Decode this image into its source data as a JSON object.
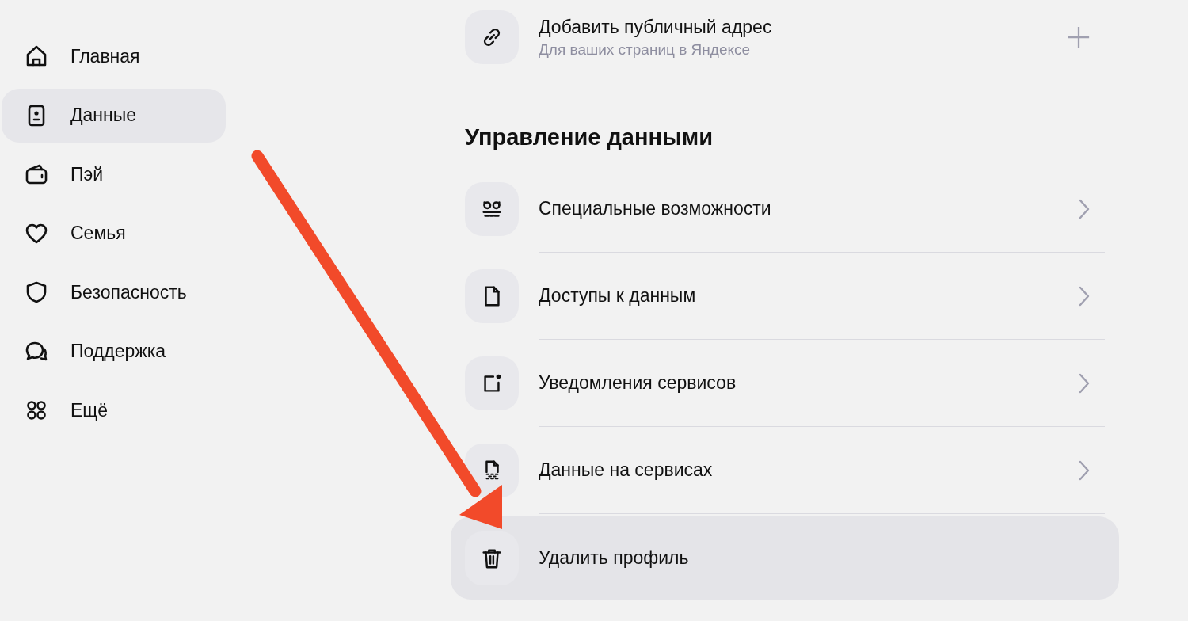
{
  "sidebar": {
    "items": [
      {
        "label": "Главная",
        "selected": false
      },
      {
        "label": "Данные",
        "selected": true
      },
      {
        "label": "Пэй",
        "selected": false
      },
      {
        "label": "Семья",
        "selected": false
      },
      {
        "label": "Безопасность",
        "selected": false
      },
      {
        "label": "Поддержка",
        "selected": false
      },
      {
        "label": "Ещё",
        "selected": false
      }
    ]
  },
  "public_address": {
    "title": "Добавить публичный адрес",
    "subtitle": "Для ваших страниц в Яндексе"
  },
  "data_management": {
    "heading": "Управление данными",
    "items": [
      {
        "label": "Специальные возможности",
        "hovered": false,
        "has_chevron": true
      },
      {
        "label": "Доступы к данным",
        "hovered": false,
        "has_chevron": true
      },
      {
        "label": "Уведомления сервисов",
        "hovered": false,
        "has_chevron": true
      },
      {
        "label": "Данные на сервисах",
        "hovered": false,
        "has_chevron": true
      },
      {
        "label": "Удалить профиль",
        "hovered": true,
        "has_chevron": false
      }
    ]
  },
  "annotation": {
    "kind": "arrow"
  }
}
